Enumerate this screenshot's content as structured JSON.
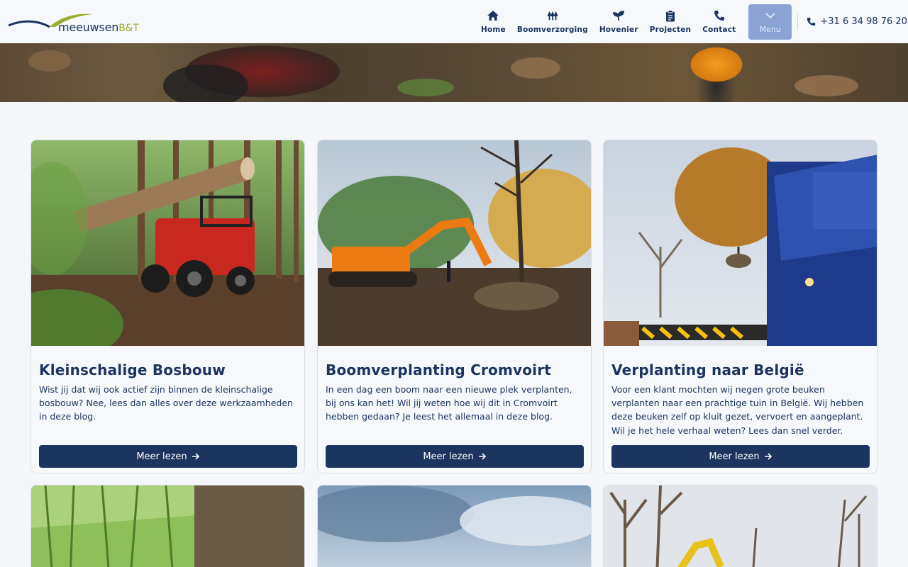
{
  "header": {
    "logo": {
      "name": "meeuwsen",
      "suffix": "B&T"
    },
    "nav": [
      {
        "label": "Home",
        "icon": "home-icon"
      },
      {
        "label": "Boomverzorging",
        "icon": "trees-icon"
      },
      {
        "label": "Hovenier",
        "icon": "sprout-icon"
      },
      {
        "label": "Projecten",
        "icon": "clipboard-icon"
      },
      {
        "label": "Contact",
        "icon": "phone-icon"
      },
      {
        "label": "Menu",
        "icon": "chevron-down-icon"
      }
    ],
    "phone": "+31 6 34 98 76 20"
  },
  "cards": [
    {
      "title": "Kleinschalige Bosbouw",
      "description": "Wist jij dat wij ook actief zijn binnen de kleinschalige bosbouw? Nee, lees dan alles over deze werkzaamheden in deze blog.",
      "button": "Meer lezen"
    },
    {
      "title": "Boomverplanting Cromvoirt",
      "description": "In een dag een boom naar een nieuwe plek verplanten, bij ons kan het! Wil jij weten hoe wij dit in Cromvoirt hebben gedaan? Je leest het allemaal in deze blog.",
      "button": "Meer lezen"
    },
    {
      "title": "Verplanting naar België",
      "description": "Voor een klant mochten wij negen grote beuken verplanten naar een prachtige tuin in België. Wij hebben deze beuken zelf op kluit gezet, vervoert en aangeplant. Wil je het hele verhaal weten? Lees dan snel verder.",
      "button": "Meer lezen"
    }
  ],
  "colors": {
    "primary": "#1b3460",
    "menu": "#8aa3d4",
    "accent": "#9aae2d"
  }
}
